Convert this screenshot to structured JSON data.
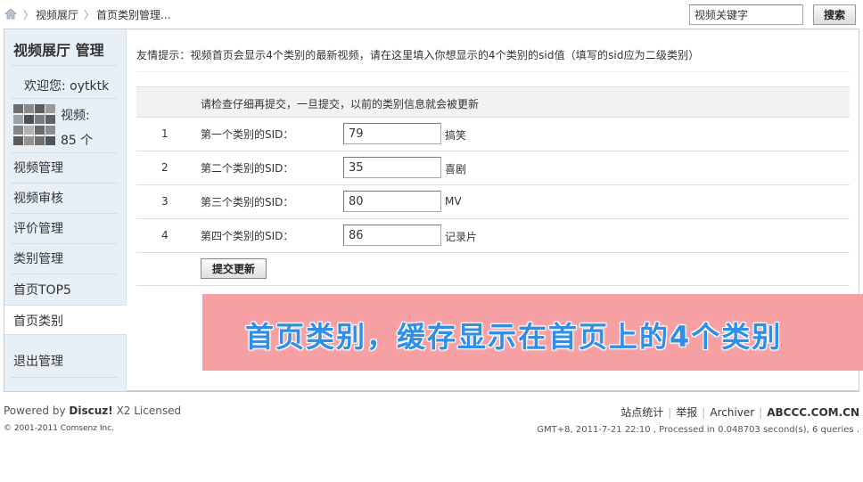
{
  "breadcrumb": {
    "items": [
      "视频展厅",
      "首页类别管理..."
    ]
  },
  "search": {
    "value": "视频关键字",
    "button_label": "搜索"
  },
  "sidebar": {
    "title": "视频展厅 管理",
    "welcome": "欢迎您: oytktk",
    "video_label": "视频:",
    "video_count": "85 个",
    "items": [
      {
        "label": "视频管理"
      },
      {
        "label": "视频审核"
      },
      {
        "label": "评价管理"
      },
      {
        "label": "类别管理"
      },
      {
        "label": "首页TOP5"
      },
      {
        "label": "首页类别"
      },
      {
        "label": "退出管理"
      }
    ],
    "active_index": 5
  },
  "main": {
    "tip": "友情提示：视频首页会显示4个类别的最新视频，请在这里填入你想显示的4个类别的sid值（填写的sid应为二级类别）",
    "table_header": "请检查仔细再提交，一旦提交，以前的类别信息就会被更新",
    "rows": [
      {
        "num": "1",
        "label": "第一个类别的SID：",
        "value": "79",
        "category": "搞笑"
      },
      {
        "num": "2",
        "label": "第二个类别的SID：",
        "value": "35",
        "category": "喜剧"
      },
      {
        "num": "3",
        "label": "第三个类别的SID：",
        "value": "80",
        "category": "MV"
      },
      {
        "num": "4",
        "label": "第四个类别的SID：",
        "value": "86",
        "category": "记录片"
      }
    ],
    "submit_label": "提交更新"
  },
  "banner": {
    "text": "首页类别，缓存显示在首页上的4个类别",
    "bg_color": "#f7a0a3",
    "text_color": "#2f8fe6"
  },
  "footer": {
    "powered_prefix": "Powered by",
    "powered_brand": "Discuz!",
    "powered_suffix": "X2 Licensed",
    "copyright": "© 2001-2011 Comsenz Inc.",
    "links": [
      "站点统计",
      "举报",
      "Archiver",
      "ABCCC.COM.CN"
    ],
    "gmt": "GMT+8, 2011-7-21 22:10 , Processed in 0.048703 second(s), 6 queries ."
  }
}
